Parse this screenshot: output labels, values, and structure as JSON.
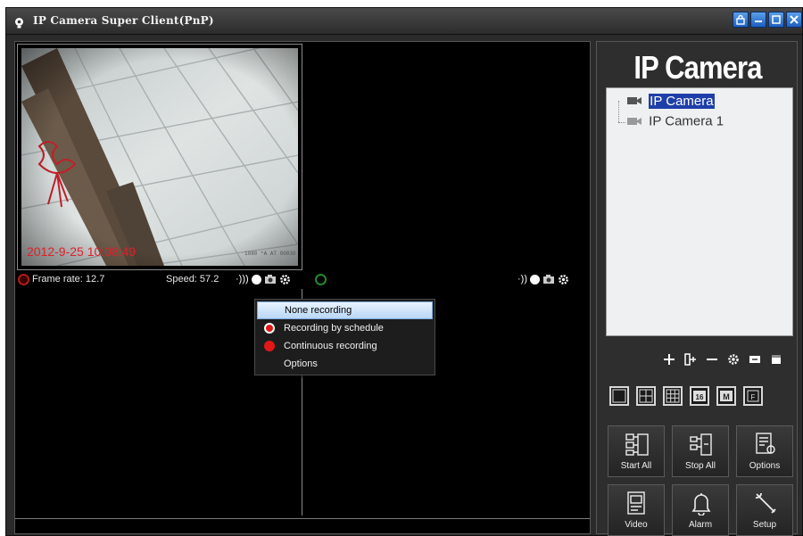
{
  "window": {
    "title": "IP Camera Super Client(PnP)"
  },
  "video": {
    "timestamp": "2012-9-25 10:08:49",
    "status": {
      "frame_rate": "Frame rate: 12.7",
      "speed": "Speed: 57.2"
    }
  },
  "record_menu": {
    "items": [
      {
        "label": "None recording",
        "selected": true,
        "icon": "none-icon"
      },
      {
        "label": "Recording by schedule",
        "selected": false,
        "icon": "schedule-record-icon"
      },
      {
        "label": "Continuous recording",
        "selected": false,
        "icon": "red-dot-icon"
      },
      {
        "label": "Options",
        "selected": false,
        "icon": ""
      }
    ]
  },
  "sidebar": {
    "brand": "IP Camera",
    "tree": [
      {
        "label": "IP Camera",
        "selected": true
      },
      {
        "label": "IP Camera 1",
        "selected": false
      }
    ],
    "buttons": [
      {
        "label": "Start All",
        "icon": "start-all-icon"
      },
      {
        "label": "Stop All",
        "icon": "stop-all-icon"
      },
      {
        "label": "Options",
        "icon": "options-icon"
      },
      {
        "label": "Video",
        "icon": "video-icon"
      },
      {
        "label": "Alarm",
        "icon": "bell-icon"
      },
      {
        "label": "Setup",
        "icon": "wrench-icon"
      }
    ]
  },
  "colors": {
    "timestamp": "#e0202a",
    "selection": "#1f3fa8",
    "record_red": "#e01818"
  }
}
